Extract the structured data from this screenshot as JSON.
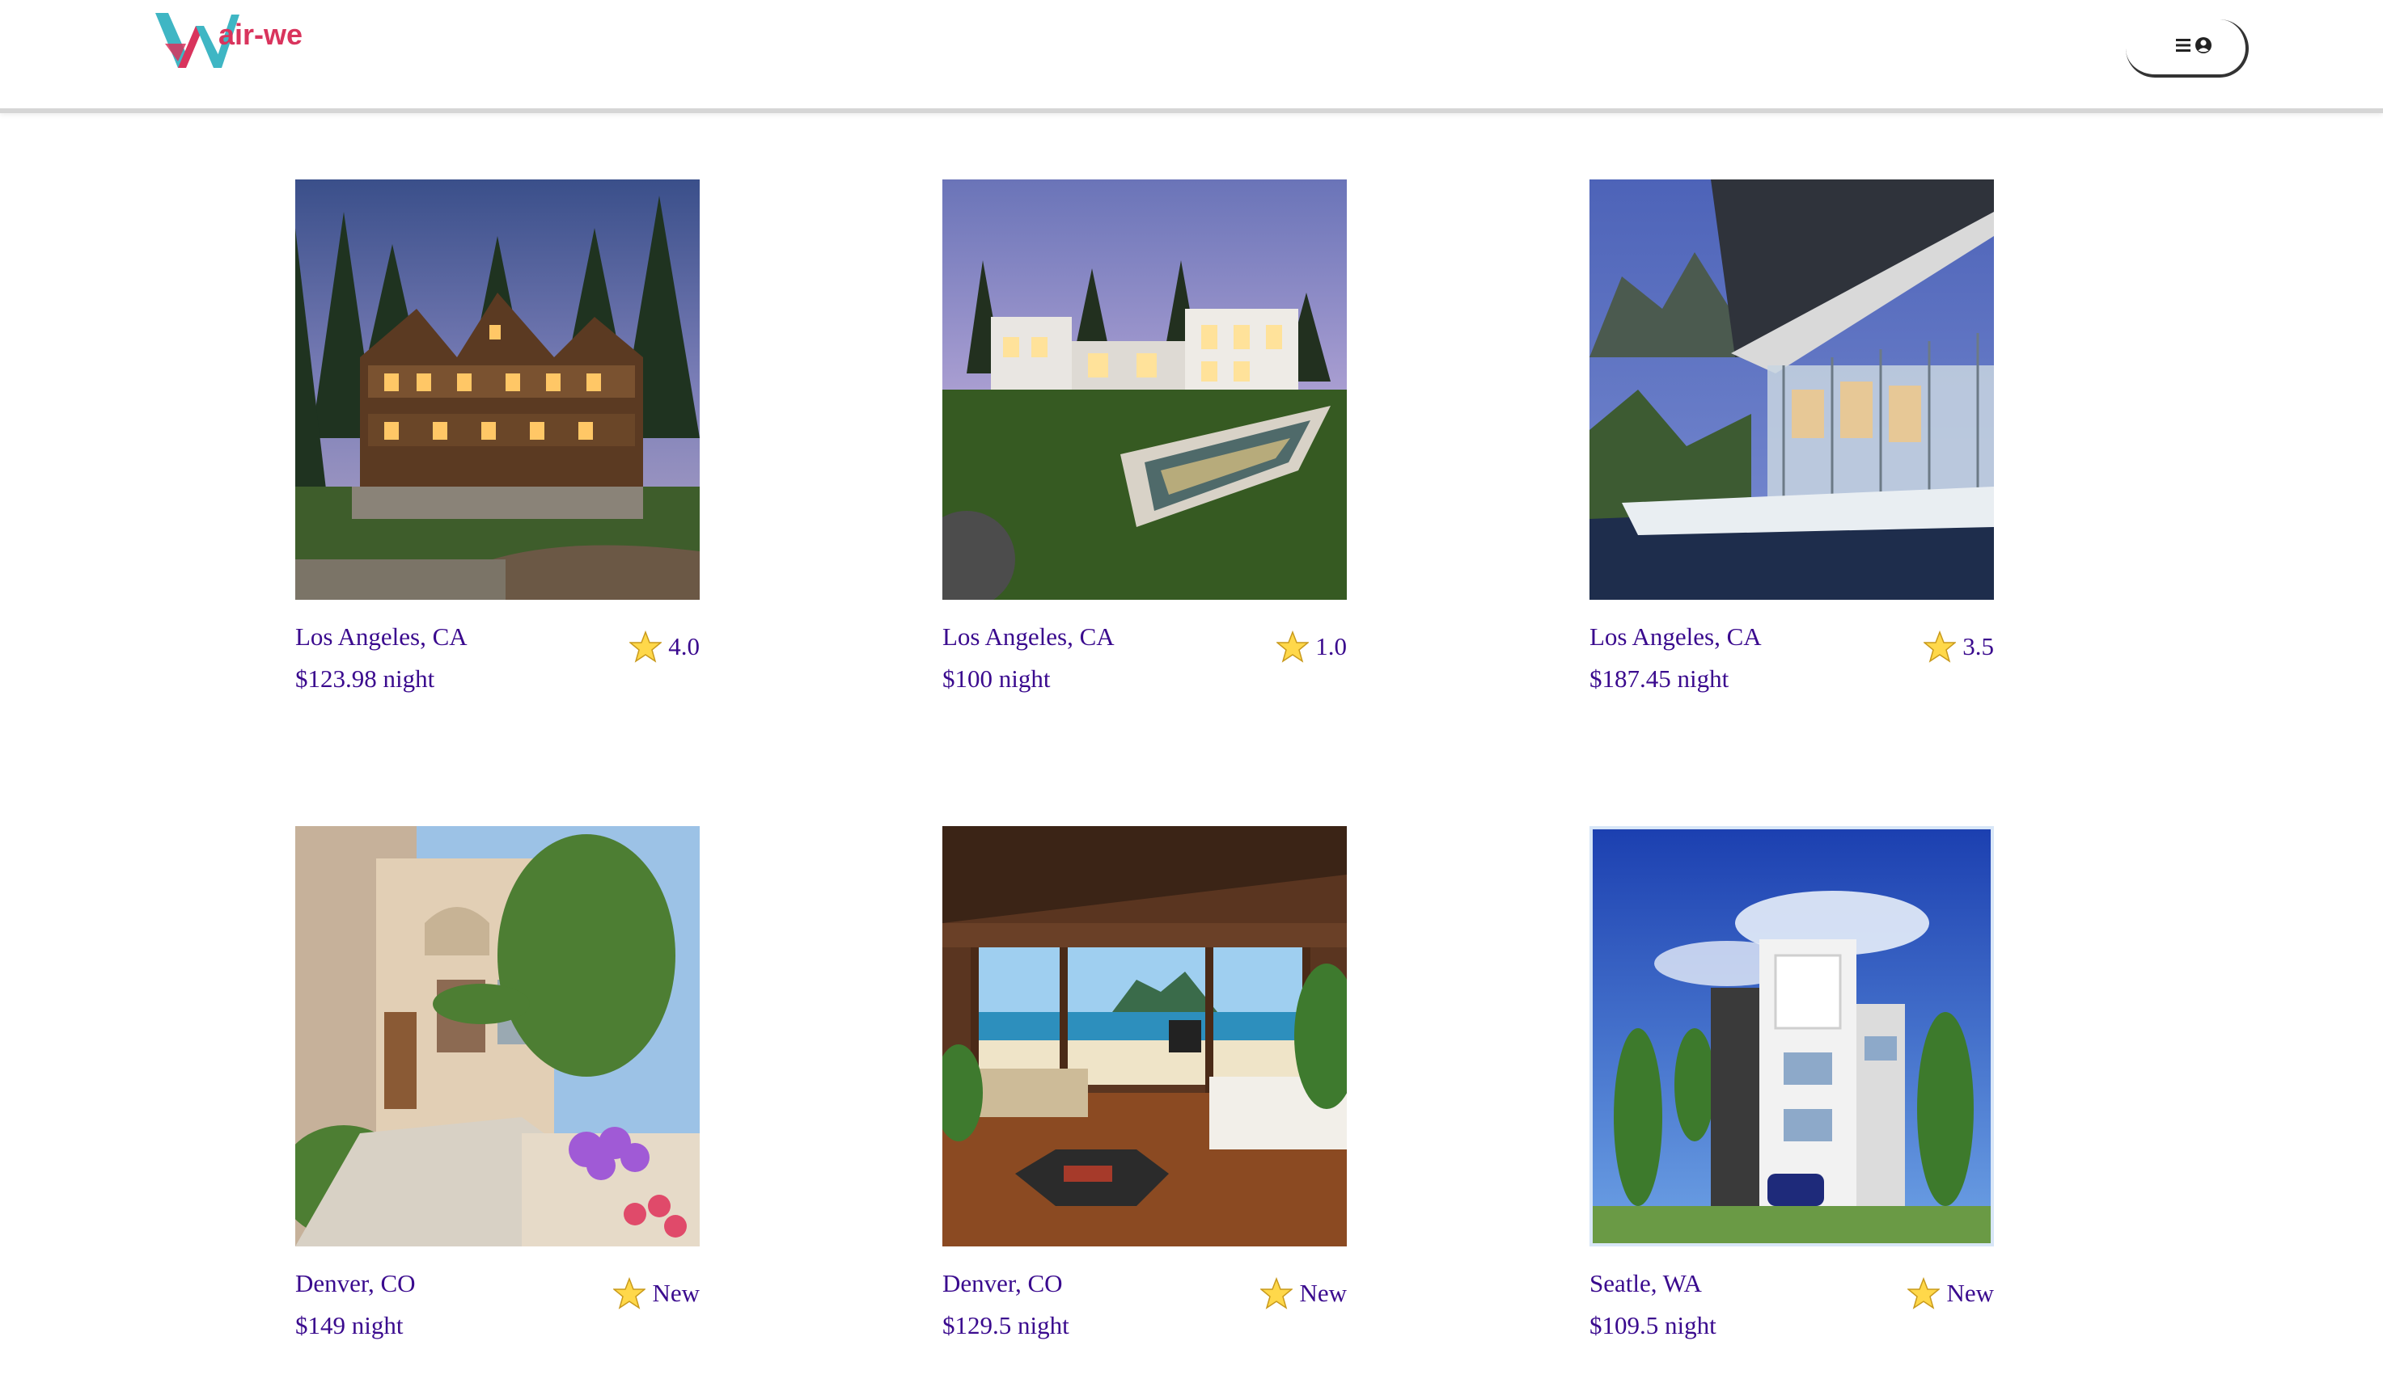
{
  "header": {
    "logo_text": "air-we",
    "menu_icon": "hamburger-icon",
    "profile_icon": "user-circle-icon"
  },
  "colors": {
    "brand_pink": "#d9345d",
    "brand_teal": "#3fb6c4",
    "text_purple": "#3a0a8e",
    "star_yellow": "#ffd84a"
  },
  "listings": [
    {
      "location": "Los Angeles, CA",
      "rating": "4.0",
      "price": "$123.98 night",
      "photo": "lodge"
    },
    {
      "location": "Los Angeles, CA",
      "rating": "1.0",
      "price": "$100 night",
      "photo": "modern-pool"
    },
    {
      "location": "Los Angeles, CA",
      "rating": "3.5",
      "price": "$187.45 night",
      "photo": "glass-villa"
    },
    {
      "location": "Denver, CO",
      "rating": "New",
      "price": "$149 night",
      "photo": "courtyard"
    },
    {
      "location": "Denver, CO",
      "rating": "New",
      "price": "$129.5 night",
      "photo": "beach-bedroom"
    },
    {
      "location": "Seatle, WA",
      "rating": "New",
      "price": "$109.5 night",
      "photo": "modern-tower"
    }
  ]
}
